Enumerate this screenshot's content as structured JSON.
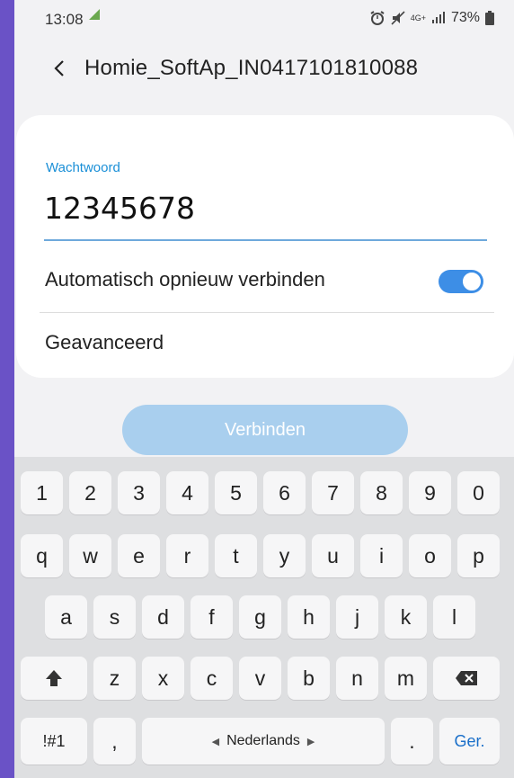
{
  "status_bar": {
    "time": "13:08",
    "network": "4G+",
    "battery": "73%"
  },
  "header": {
    "title": "Homie_SoftAp_IN0417101810088"
  },
  "wifi_form": {
    "password_label": "Wachtwoord",
    "password_value": "12345678",
    "auto_reconnect_label": "Automatisch opnieuw verbinden",
    "auto_reconnect_on": true,
    "advanced_label": "Geavanceerd",
    "connect_label": "Verbinden"
  },
  "keyboard": {
    "numbers": [
      "1",
      "2",
      "3",
      "4",
      "5",
      "6",
      "7",
      "8",
      "9",
      "0"
    ],
    "row1": [
      "q",
      "w",
      "e",
      "r",
      "t",
      "y",
      "u",
      "i",
      "o",
      "p"
    ],
    "row2": [
      "a",
      "s",
      "d",
      "f",
      "g",
      "h",
      "j",
      "k",
      "l"
    ],
    "row3": [
      "z",
      "x",
      "c",
      "v",
      "b",
      "n",
      "m"
    ],
    "symbols_label": "!#1",
    "comma": ",",
    "space_label": "Nederlands",
    "period": ".",
    "go_label": "Ger."
  },
  "colors": {
    "accent": "#1a8fd7",
    "toggle": "#3d8ee6",
    "connect_button": "#a9cfee",
    "frame": "#6a52c6"
  }
}
